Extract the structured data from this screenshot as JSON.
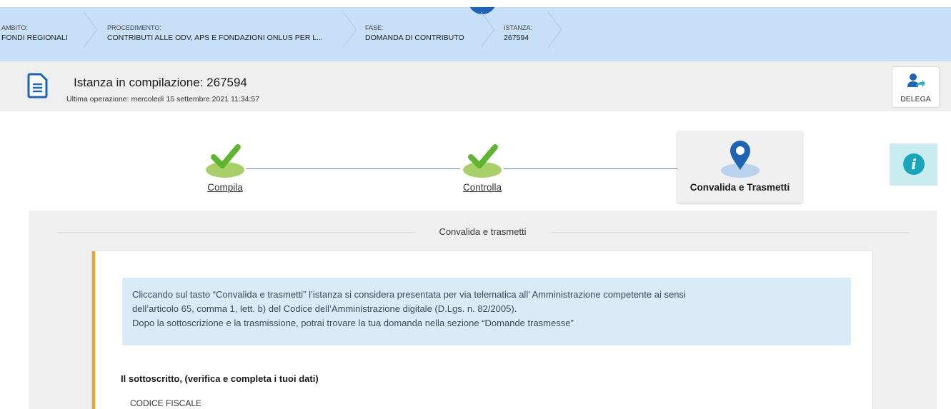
{
  "breadcrumb": [
    {
      "caption": "AMBITO:",
      "value": "FONDI REGIONALI"
    },
    {
      "caption": "PROCEDIMENTO:",
      "value": "CONTRIBUTI ALLE ODV, APS E FONDAZIONI ONLUS PER L..."
    },
    {
      "caption": "FASE:",
      "value": "DOMANDA DI CONTRIBUTO"
    },
    {
      "caption": "ISTANZA:",
      "value": "267594"
    }
  ],
  "header": {
    "title": "Istanza in compilazione: 267594",
    "subtitle": "Ultima operazione: mercoledì 15 settembre 2021 11:34:57",
    "delega_label": "DELEGA"
  },
  "stepper": {
    "steps": [
      {
        "label": "Compila",
        "status": "done"
      },
      {
        "label": "Controlla",
        "status": "done"
      },
      {
        "label": "Convalida e Trasmetti",
        "status": "active"
      }
    ]
  },
  "panel": {
    "title": "Convalida e trasmetti",
    "notice_lines": [
      "Cliccando sul tasto “Convalida e trasmetti” l’istanza si considera presentata per via telematica all’ Amministrazione competente ai sensi",
      "dell’articolo 65, comma 1, lett. b) del Codice dell’Amministrazione digitale (D.Lgs. n. 82/2005).",
      "Dopo la sottoscrizione e la trasmissione, potrai trovare la tua domanda nella sezione “Domande trasmesse”"
    ],
    "section_title": "Il sottoscritto, (verifica e completa i tuoi dati)",
    "field_label": "CODICE FISCALE"
  },
  "colors": {
    "crumb_bg": "#c7dff7",
    "accent_blue": "#1e63b5",
    "check_green": "#5fb52f",
    "orange_border": "#f4a21c",
    "info_teal": "#1aa5bb"
  },
  "icons": [
    "document-icon",
    "delegate-user-icon",
    "check-icon",
    "location-pin-icon",
    "info-icon"
  ]
}
